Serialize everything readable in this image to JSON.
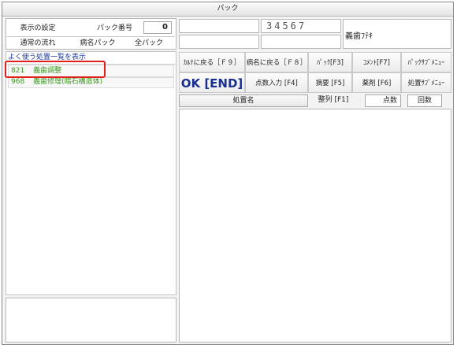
{
  "window": {
    "title": "パック"
  },
  "left_top": {
    "display_settings": "表示の設定",
    "pack_number_label": "パック番号",
    "pack_number_value": "0",
    "normal_flow": "通常の流れ",
    "disease_pack": "病名パック",
    "all_pack": "全パック"
  },
  "common_list": {
    "header_link": "よく使う処置一覧を表示",
    "items": [
      {
        "code": "821",
        "name": "義歯調整"
      },
      {
        "code": "968",
        "name": "義歯修理(暗石構造体)"
      }
    ]
  },
  "info": {
    "patient_number": "34567",
    "denture_label": "義歯ﾌﾃｷ"
  },
  "toolbar": {
    "back_to_chart": "ｶﾙﾃに戻る［Ｆ９］",
    "back_to_disease": "病名に戻る［Ｆ８］",
    "pack": "ﾊﾟｯｸ[F3]",
    "comment": "ｺﾒﾝﾄ[F7]",
    "pack_sub_menu": "ﾊﾟｯｸｻﾌﾞﾒﾆｭｰ",
    "ok_end": "OK [END]",
    "points_input": "点数入力 [F4]",
    "summary": "摘要 [F5]",
    "medicine": "薬剤 [F6]",
    "treatment_sub_menu": "処置ｻﾌﾞﾒﾆｭｰ"
  },
  "table": {
    "col_treatment_name": "処置名",
    "sort": "整列 [F1]",
    "col_points": "点数",
    "col_count": "回数"
  },
  "colors": {
    "highlight_border": "#e0201c",
    "item_text": "#3a9a1c",
    "link_text": "#1a3aa0",
    "ok_text": "#1a3090"
  }
}
